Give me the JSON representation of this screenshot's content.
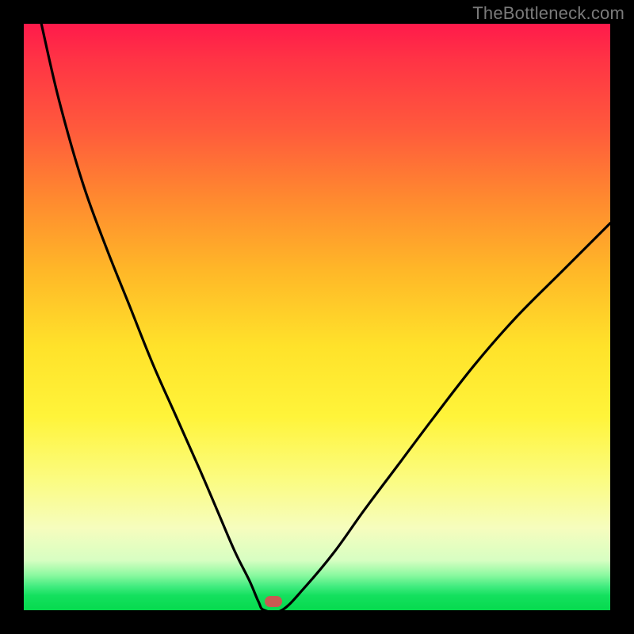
{
  "watermark": "TheBottleneck.com",
  "colors": {
    "frame": "#000000",
    "curve": "#000000",
    "marker": "#c75a52",
    "gradient_stops": [
      "#ff1a4b",
      "#ff3345",
      "#ff5a3c",
      "#ff8a2f",
      "#ffb728",
      "#ffe22a",
      "#fff43a",
      "#fbfc83",
      "#f6fdbe",
      "#d7fec2",
      "#8cf9a0",
      "#3feb7e",
      "#14e05e",
      "#06da4e"
    ]
  },
  "chart_data": {
    "type": "line",
    "title": "",
    "xlabel": "",
    "ylabel": "",
    "xlim": [
      0,
      100
    ],
    "ylim": [
      0,
      100
    ],
    "description": "V-shaped bottleneck curve over a vertical green-to-red gradient. Minimum (optimum) near x≈41 at y≈0. Left branch rises steeply to y=100 at x≈3; right branch rises more gently to y≈66 at x=100.",
    "series": [
      {
        "name": "left-branch",
        "x": [
          3,
          6,
          10,
          14,
          18,
          22,
          26,
          30,
          33,
          36,
          38.5,
          40,
          41
        ],
        "y": [
          100,
          87,
          73,
          62,
          52,
          42,
          33,
          24,
          17,
          10,
          5,
          1.5,
          0
        ]
      },
      {
        "name": "flat-bottom",
        "x": [
          41,
          44
        ],
        "y": [
          0,
          0
        ]
      },
      {
        "name": "right-branch",
        "x": [
          44,
          48,
          53,
          58,
          64,
          70,
          77,
          84,
          92,
          100
        ],
        "y": [
          0,
          4,
          10,
          17,
          25,
          33,
          42,
          50,
          58,
          66
        ]
      }
    ],
    "marker": {
      "x": 42.5,
      "y": 1.5
    }
  }
}
